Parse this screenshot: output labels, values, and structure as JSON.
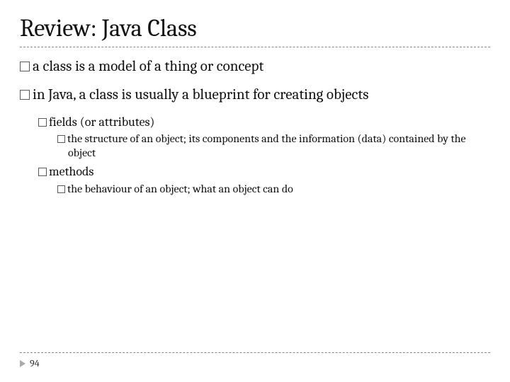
{
  "title": "Review: Java Class",
  "bullets": {
    "p1": "a class is a model of a thing or concept",
    "p2": "in Java, a class is usually a blueprint for creating objects",
    "p2a": "fields (or attributes)",
    "p2a1": "the structure of an object; its components and the information (data) contained by the object",
    "p2b": "methods",
    "p2b1": "the behaviour of an object; what an object can do"
  },
  "page_number": "94"
}
